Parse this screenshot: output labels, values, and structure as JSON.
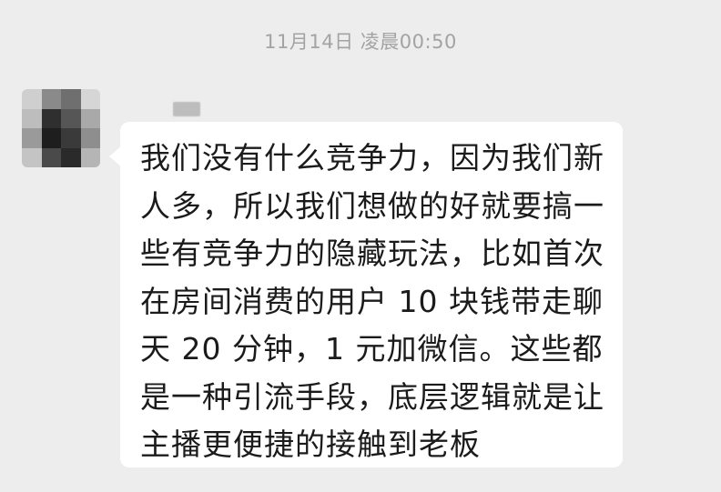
{
  "chat": {
    "timestamp": "11月14日 凌晨00:50",
    "message": {
      "lines": [
        "我们没有什么竞争力，因为我们新",
        "人多，所以我们想做的好就要搞一",
        "些有竞争力的隐藏玩法，比如首次",
        "在房间消费的用户 10 块钱带走聊",
        "天 20 分钟，1 元加微信。这些都",
        "是一种引流手段，底层逻辑就是让",
        "主播更便捷的接触到老板"
      ]
    },
    "avatar_icon": "pixelated-avatar-icon",
    "colors": {
      "background": "#ededed",
      "bubble": "#ffffff",
      "text": "#1b1b1b",
      "timestamp": "#a3a3a3"
    }
  }
}
